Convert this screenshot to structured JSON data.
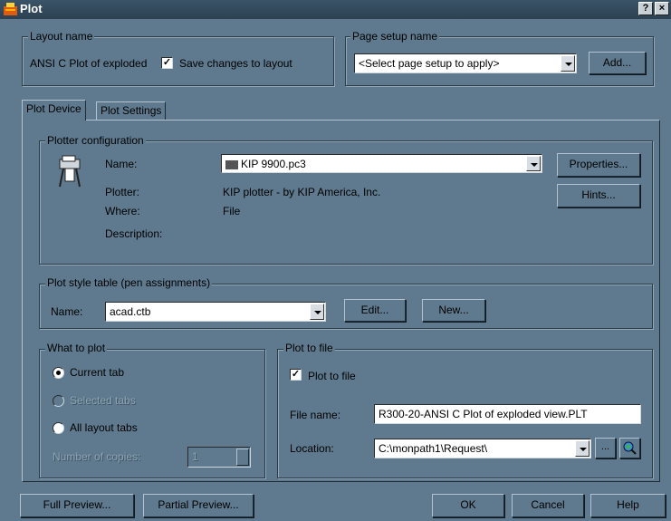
{
  "window": {
    "title": "Plot",
    "help_glyph": "?",
    "close_glyph": "×"
  },
  "layout": {
    "legend": "Layout name",
    "name": "ANSI C Plot of exploded",
    "save_changes": "Save changes to layout",
    "save_checked": true
  },
  "page_setup": {
    "legend": "Page setup name",
    "select_value": "<Select page setup to apply>",
    "add_label": "Add..."
  },
  "tabs": [
    "Plot Device",
    "Plot Settings"
  ],
  "plotter": {
    "legend": "Plotter configuration",
    "name_label": "Name:",
    "name_value": "KIP 9900.pc3",
    "plotter_label": "Plotter:",
    "plotter_value": "KIP plotter  - by KIP America, Inc.",
    "where_label": "Where:",
    "where_value": "File",
    "description_label": "Description:",
    "properties_label": "Properties...",
    "hints_label": "Hints..."
  },
  "plot_style": {
    "legend": "Plot style table (pen assignments)",
    "name_label": "Name:",
    "name_value": "acad.ctb",
    "edit_label": "Edit...",
    "new_label": "New..."
  },
  "what_to_plot": {
    "legend": "What to plot",
    "current_tab": "Current tab",
    "selected_tabs": "Selected tabs",
    "all_layout_tabs": "All layout tabs",
    "copies_label": "Number of copies:",
    "copies_value": "1"
  },
  "plot_to_file": {
    "legend": "Plot to file",
    "checkbox_label": "Plot to file",
    "checked": true,
    "file_name_label": "File name:",
    "file_name_value": "R300-20-ANSI C Plot of exploded view.PLT",
    "location_label": "Location:",
    "location_value": "C:\\monpath1\\Request\\"
  },
  "footer": {
    "full_preview": "Full Preview...",
    "partial_preview": "Partial Preview...",
    "ok": "OK",
    "cancel": "Cancel",
    "help": "Help"
  }
}
